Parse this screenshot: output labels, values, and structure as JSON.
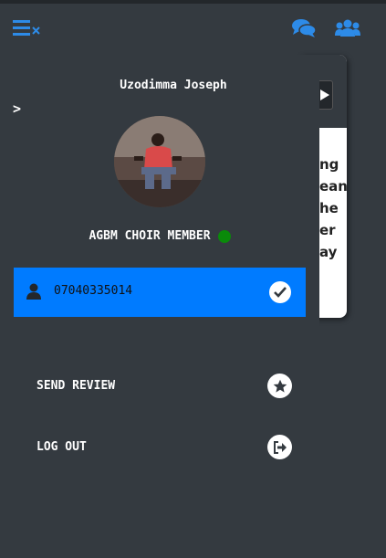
{
  "header": {
    "menu_icon": "menu-close-icon",
    "chat_icon": "chat-icon",
    "group_icon": "group-icon",
    "accent": "#2d8be8"
  },
  "background_card": {
    "lines": [
      "ng",
      "ean",
      "he",
      "er",
      "ay"
    ]
  },
  "profile": {
    "name": "Uzodimma Joseph",
    "role": "AGBM CHOIR MEMBER",
    "status_color": "#0a8a0a"
  },
  "phone": {
    "number": "07040335014",
    "bar_color": "#007bff"
  },
  "menu": {
    "send_review": "SEND REVIEW",
    "log_out": "LOG OUT"
  }
}
